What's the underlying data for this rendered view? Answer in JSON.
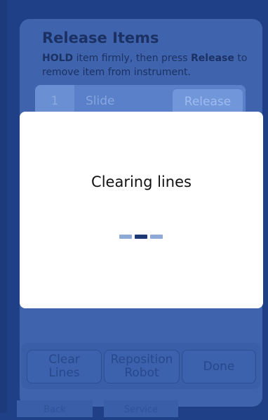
{
  "release_items": {
    "title": "Release Items",
    "instruction_bold1": "HOLD",
    "instruction_mid": " item firmly, then press ",
    "instruction_bold2": "Release",
    "instruction_end": " to remove item from instrument.",
    "item": {
      "number": "1",
      "name": "Slide",
      "release_label": "Release"
    }
  },
  "modal": {
    "message": "Clearing lines",
    "progress_colors": [
      "#8fa9d6",
      "#1e3a74",
      "#8fa9d6"
    ]
  },
  "actions": {
    "clear_lines": "Clear\nLines",
    "reposition_robot": "Reposition\nRobot",
    "done": "Done"
  },
  "bottom_tabs": {
    "tab1": "Back",
    "tab2": "Service"
  }
}
